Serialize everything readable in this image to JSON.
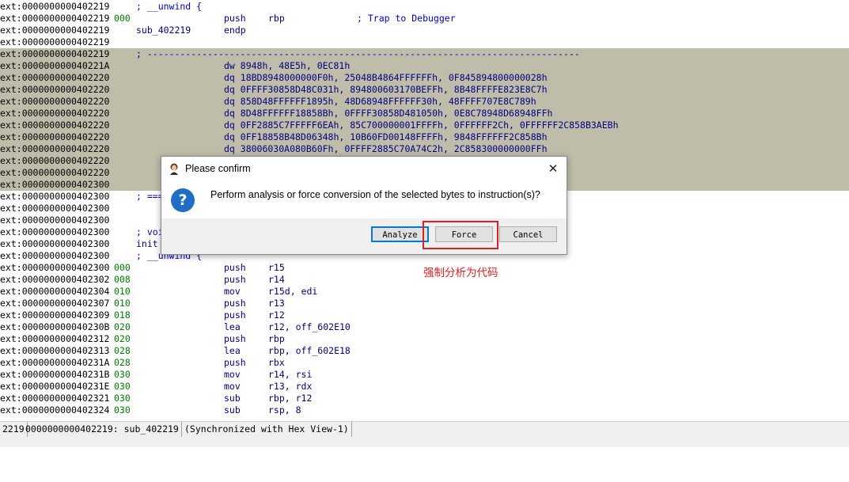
{
  "listing": [
    {
      "addr": "ext:0000000000402219",
      "stk": "",
      "lbl": "",
      "mn": "",
      "op": "",
      "cm": "",
      "cm2": "; __unwind {",
      "sel": false
    },
    {
      "addr": "ext:0000000000402219",
      "stk": "000",
      "lbl": "",
      "mn": "push",
      "op": "rbp",
      "cm": "; Trap to Debugger",
      "cm2": "",
      "sel": false
    },
    {
      "addr": "ext:0000000000402219",
      "stk": "",
      "lbl": "sub_402219",
      "mn": "endp",
      "op": "",
      "cm": "",
      "cm2": "",
      "sel": false
    },
    {
      "addr": "ext:0000000000402219",
      "stk": "",
      "lbl": "",
      "mn": "",
      "op": "",
      "cm": "",
      "cm2": "",
      "sel": false
    },
    {
      "addr": "ext:0000000000402219",
      "stk": "",
      "lbl": "",
      "mn": "",
      "op": "",
      "cm": "",
      "cm2": "; -------------------------------------------------------------------------------",
      "sel": true
    },
    {
      "addr": "ext:000000000040221A",
      "stk": "",
      "lbl": "",
      "mn": "dw 8948h, 48E5h, 0EC81h",
      "op": "",
      "cm": "",
      "cm2": "",
      "sel": true
    },
    {
      "addr": "ext:0000000000402220",
      "stk": "",
      "lbl": "",
      "mn": "dq 18BD8948000000F0h, 25048B4864FFFFFFh, 0F845894800000028h",
      "op": "",
      "cm": "",
      "cm2": "",
      "sel": true
    },
    {
      "addr": "ext:0000000000402220",
      "stk": "",
      "lbl": "",
      "mn": "dq 0FFFF30858D48C031h, 894800603170BEFFh, 8B48FFFFE823E8C7h",
      "op": "",
      "cm": "",
      "cm2": "",
      "sel": true
    },
    {
      "addr": "ext:0000000000402220",
      "stk": "",
      "lbl": "",
      "mn": "dq 858D48FFFFFF1895h, 48D68948FFFFFF30h, 48FFFF707E8C789h",
      "op": "",
      "cm": "",
      "cm2": "",
      "sel": true
    },
    {
      "addr": "ext:0000000000402220",
      "stk": "",
      "lbl": "",
      "mn": "dq 8D48FFFFFF18858Bh, 0FFFF30858D481050h, 0E8C78948D68948FFh",
      "op": "",
      "cm": "",
      "cm2": "",
      "sel": true
    },
    {
      "addr": "ext:0000000000402220",
      "stk": "",
      "lbl": "",
      "mn": "dq 0FF2885C7FFFFF6EAh, 85C700000001FFFFh, 0FFFFFF2Ch, 0FFFFFF2C858B3AEBh",
      "op": "",
      "cm": "",
      "cm2": "",
      "sel": true
    },
    {
      "addr": "ext:0000000000402220",
      "stk": "",
      "lbl": "",
      "mn": "dq 0FF18858B48D06348h, 10B60FD00148FFFFh, 9848FFFFFF2C858Bh",
      "op": "",
      "cm": "",
      "cm2": "",
      "sel": true
    },
    {
      "addr": "ext:0000000000402220",
      "stk": "",
      "lbl": "",
      "mn": "dq 38006030A080B60Fh, 0FFFF2885C70A74C2h, 2C858300000000FFh",
      "op": "",
      "cm": "",
      "cm2": "",
      "sel": true
    },
    {
      "addr": "ext:0000000000402220",
      "stk": "",
      "lbl": "",
      "mn": "",
      "op": "",
      "cm": "",
      "cm2": "",
      "sel": true
    },
    {
      "addr": "ext:0000000000402220",
      "stk": "",
      "lbl": "",
      "mn": "",
      "op": "",
      "cm": "",
      "cm2": "",
      "sel": true
    },
    {
      "addr": "ext:0000000000402300",
      "stk": "",
      "lbl": "",
      "mn": "",
      "op": "",
      "cm": "",
      "cm2": "",
      "sel": true
    },
    {
      "addr": "ext:0000000000402300",
      "stk": "",
      "lbl": "",
      "mn": "",
      "op": "",
      "cm": "",
      "cm2": "; ===",
      "sel": false
    },
    {
      "addr": "ext:0000000000402300",
      "stk": "",
      "lbl": "",
      "mn": "",
      "op": "",
      "cm": "",
      "cm2": "",
      "sel": false
    },
    {
      "addr": "ext:0000000000402300",
      "stk": "",
      "lbl": "",
      "mn": "",
      "op": "",
      "cm": "",
      "cm2": "",
      "sel": false
    },
    {
      "addr": "ext:0000000000402300",
      "stk": "",
      "lbl": "",
      "mn": "",
      "op": "",
      "cm": "",
      "cm2": "; voi",
      "sel": false
    },
    {
      "addr": "ext:0000000000402300",
      "stk": "",
      "lbl": "init",
      "mn": "",
      "op": "",
      "cm": "",
      "cm2": "",
      "sel": false
    },
    {
      "addr": "ext:0000000000402300",
      "stk": "",
      "lbl": "",
      "mn": "",
      "op": "",
      "cm": "",
      "cm2": "; __unwind {",
      "sel": false
    },
    {
      "addr": "ext:0000000000402300",
      "stk": "000",
      "lbl": "",
      "mn": "push",
      "op": "r15",
      "cm": "",
      "cm2": "",
      "sel": false
    },
    {
      "addr": "ext:0000000000402302",
      "stk": "008",
      "lbl": "",
      "mn": "push",
      "op": "r14",
      "cm": "",
      "cm2": "",
      "sel": false
    },
    {
      "addr": "ext:0000000000402304",
      "stk": "010",
      "lbl": "",
      "mn": "mov",
      "op": "r15d, edi",
      "cm": "",
      "cm2": "",
      "sel": false
    },
    {
      "addr": "ext:0000000000402307",
      "stk": "010",
      "lbl": "",
      "mn": "push",
      "op": "r13",
      "cm": "",
      "cm2": "",
      "sel": false
    },
    {
      "addr": "ext:0000000000402309",
      "stk": "018",
      "lbl": "",
      "mn": "push",
      "op": "r12",
      "cm": "",
      "cm2": "",
      "sel": false
    },
    {
      "addr": "ext:000000000040230B",
      "stk": "020",
      "lbl": "",
      "mn": "lea",
      "op": "r12, off_602E10",
      "cm": "",
      "cm2": "",
      "sel": false
    },
    {
      "addr": "ext:0000000000402312",
      "stk": "020",
      "lbl": "",
      "mn": "push",
      "op": "rbp",
      "cm": "",
      "cm2": "",
      "sel": false
    },
    {
      "addr": "ext:0000000000402313",
      "stk": "028",
      "lbl": "",
      "mn": "lea",
      "op": "rbp, off_602E18",
      "cm": "",
      "cm2": "",
      "sel": false
    },
    {
      "addr": "ext:000000000040231A",
      "stk": "028",
      "lbl": "",
      "mn": "push",
      "op": "rbx",
      "cm": "",
      "cm2": "",
      "sel": false
    },
    {
      "addr": "ext:000000000040231B",
      "stk": "030",
      "lbl": "",
      "mn": "mov",
      "op": "r14, rsi",
      "cm": "",
      "cm2": "",
      "sel": false
    },
    {
      "addr": "ext:000000000040231E",
      "stk": "030",
      "lbl": "",
      "mn": "mov",
      "op": "r13, rdx",
      "cm": "",
      "cm2": "",
      "sel": false
    },
    {
      "addr": "ext:0000000000402321",
      "stk": "030",
      "lbl": "",
      "mn": "sub",
      "op": "rbp, r12",
      "cm": "",
      "cm2": "",
      "sel": false
    },
    {
      "addr": "ext:0000000000402324",
      "stk": "030",
      "lbl": "",
      "mn": "sub",
      "op": "rsp, 8",
      "cm": "",
      "cm2": "",
      "sel": false
    }
  ],
  "status": {
    "cell1": "2219",
    "cell2": "0000000000402219: sub_402219",
    "cell3": "(Synchronized with Hex View-1)"
  },
  "dialog": {
    "title": "Please confirm",
    "message": "Perform analysis or force conversion of the selected bytes to instruction(s)?",
    "close": "✕",
    "question_mark": "?",
    "buttons": {
      "analyze": "Analyze",
      "force": "Force",
      "cancel": "Cancel"
    }
  },
  "annotation": "强制分析为代码",
  "colors": {
    "selection": "#c0bcaa",
    "annotation": "#e02020",
    "accent": "#0078d7"
  }
}
